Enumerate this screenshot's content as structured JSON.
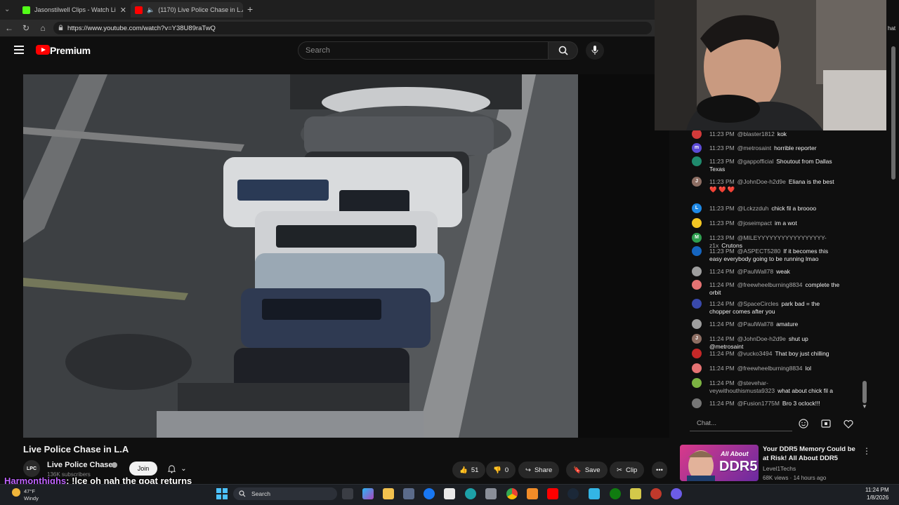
{
  "browser": {
    "tabs": [
      {
        "label": "Jasonstilwell Clips - Watch Li",
        "icon_color": "#53fc18"
      },
      {
        "label": "(1170) Live Police Chase in L.A",
        "icon_color": "#ff0000"
      }
    ],
    "new_tab": "+",
    "url": "https://www.youtube.com/watch?v=Y38U89raTwQ"
  },
  "youtube": {
    "brand": "Premium",
    "search_placeholder": "Search",
    "video": {
      "title": "Live Police Chase in L.A",
      "channel": {
        "name": "Live Police Chases",
        "subscribers": "136K subscribers",
        "avatar_text": "LPC"
      },
      "join_label": "Join",
      "likes": "51",
      "dislikes": "0",
      "share_label": "Share",
      "save_label": "Save",
      "clip_label": "Clip"
    },
    "chat": {
      "messages": [
        {
          "time": "11:23 PM",
          "user": "@blaster1812",
          "text": "kok",
          "avatar": "",
          "color": "#d23a3a"
        },
        {
          "time": "11:23 PM",
          "user": "@metrosaint",
          "text": "horrible reporter",
          "avatar": "m",
          "color": "#5c4bd6"
        },
        {
          "time": "11:23 PM",
          "user": "@gappofficial",
          "text": "Shoutout from Dallas Texas",
          "avatar": "",
          "color": "#1f8a6d"
        },
        {
          "time": "11:23 PM",
          "user": "@JohnDoe-h2d9e",
          "text": "Eliana is the best",
          "hearts": "❤️ ❤️ ❤️",
          "avatar": "J",
          "color": "#8d6e63"
        },
        {
          "time": "11:23 PM",
          "user": "@Lckzzduh",
          "text": "chick fil a broooo",
          "avatar": "L",
          "color": "#1e88e5"
        },
        {
          "time": "11:23 PM",
          "user": "@joseimpact",
          "text": "im a wot",
          "avatar": "",
          "color": "#f3c623"
        },
        {
          "time": "11:23 PM",
          "user": "@MILEYYYYYYYYYYYYYYYYY-z1x",
          "text": "Crutons",
          "avatar": "M",
          "color": "#2e9e4f"
        },
        {
          "time": "11:23 PM",
          "user": "@ASPECT5280",
          "text": "If it becomes this easy everybody going to be running lmao",
          "avatar": "",
          "color": "#1565c0"
        },
        {
          "time": "11:24 PM",
          "user": "@PaulWall78",
          "text": "weak",
          "avatar": "",
          "color": "#9e9e9e"
        },
        {
          "time": "11:24 PM",
          "user": "@freewheelburning8834",
          "text": "complete the orbit",
          "avatar": "",
          "color": "#e57373"
        },
        {
          "time": "11:24 PM",
          "user": "@SpaceCircles",
          "text": "park bad = the chopper comes after you",
          "avatar": "",
          "color": "#3949ab"
        },
        {
          "time": "11:24 PM",
          "user": "@PaulWall78",
          "text": "amature",
          "avatar": "",
          "color": "#9e9e9e"
        },
        {
          "time": "11:24 PM",
          "user": "@JohnDoe-h2d9e",
          "text": "shut up @metrosaint",
          "avatar": "J",
          "color": "#8d6e63"
        },
        {
          "time": "11:24 PM",
          "user": "@vucko3494",
          "text": "That boy just chilling",
          "avatar": "",
          "color": "#c62828"
        },
        {
          "time": "11:24 PM",
          "user": "@freewheelburning8834",
          "text": "lol",
          "avatar": "",
          "color": "#e57373"
        },
        {
          "time": "11:24 PM",
          "user": "@stevehar­veywithouthismusta9323",
          "text": "what about chick fil a",
          "avatar": "",
          "color": "#7cb342"
        },
        {
          "time": "11:24 PM",
          "user": "@Fusion1775M",
          "text": "Bro 3 oclock!!!",
          "avatar": "",
          "color": "#757575"
        }
      ],
      "input_placeholder": "Chat..."
    },
    "recommendation": {
      "thumb_text_1": "All About",
      "thumb_text_2": "DDR5",
      "title": "Your DDR5 Memory Could be at Risk! All About DDR5",
      "channel": "Level1Techs",
      "meta": "68K views · 14 hours ago"
    }
  },
  "overlay": {
    "chat_user": "Harmonthighs",
    "chat_text": ": !lce oh nah the goat returns",
    "ext_label": "hat"
  },
  "taskbar": {
    "weather_temp": "47°F",
    "weather_desc": "Windy",
    "search_label": "Search",
    "time": "11:24 PM",
    "date": "1/8/2026"
  }
}
